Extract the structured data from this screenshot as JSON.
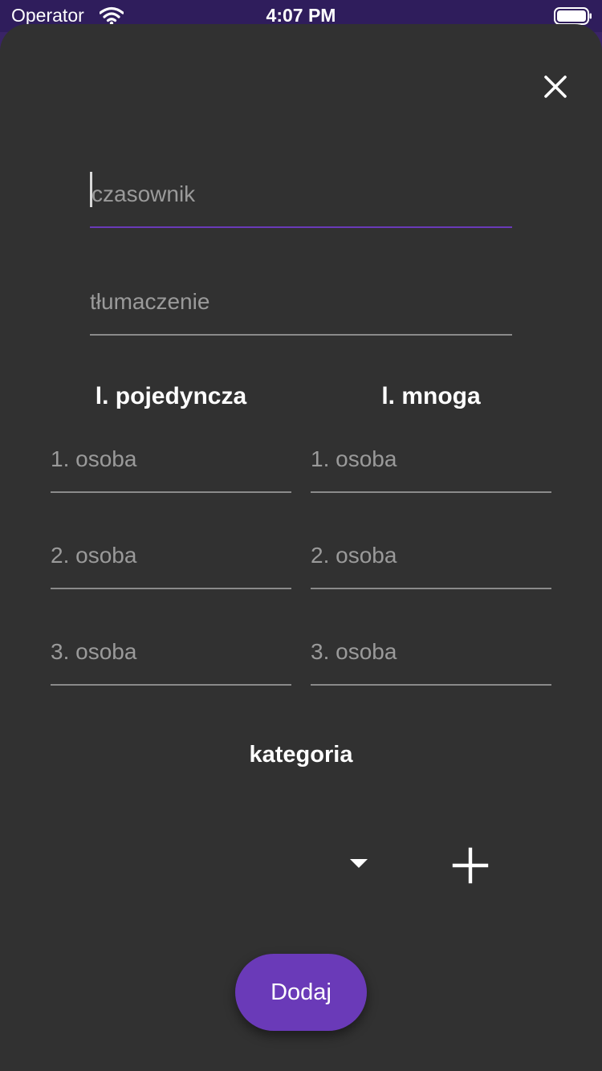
{
  "status_bar": {
    "carrier": "Operator",
    "time": "4:07 PM",
    "wifi_icon": "wifi-icon",
    "battery_icon": "battery-icon"
  },
  "form": {
    "close_icon": "close-icon",
    "verb_placeholder": "czasownik",
    "translation_placeholder": "tłumaczenie",
    "singular_header": "l. pojedyncza",
    "plural_header": "l. mnoga",
    "singular": {
      "first": "1. osoba",
      "second": "2. osoba",
      "third": "3. osoba"
    },
    "plural": {
      "first": "1. osoba",
      "second": "2. osoba",
      "third": "3. osoba"
    },
    "category_title": "kategoria",
    "category_dropdown_icon": "chevron-down-icon",
    "add_category_icon": "plus-icon",
    "submit_label": "Dodaj"
  },
  "colors": {
    "accent": "#6a3ab8",
    "status_bar": "#2f1d5c",
    "sheet_background": "#313131",
    "underline": "#8a8a8a"
  }
}
